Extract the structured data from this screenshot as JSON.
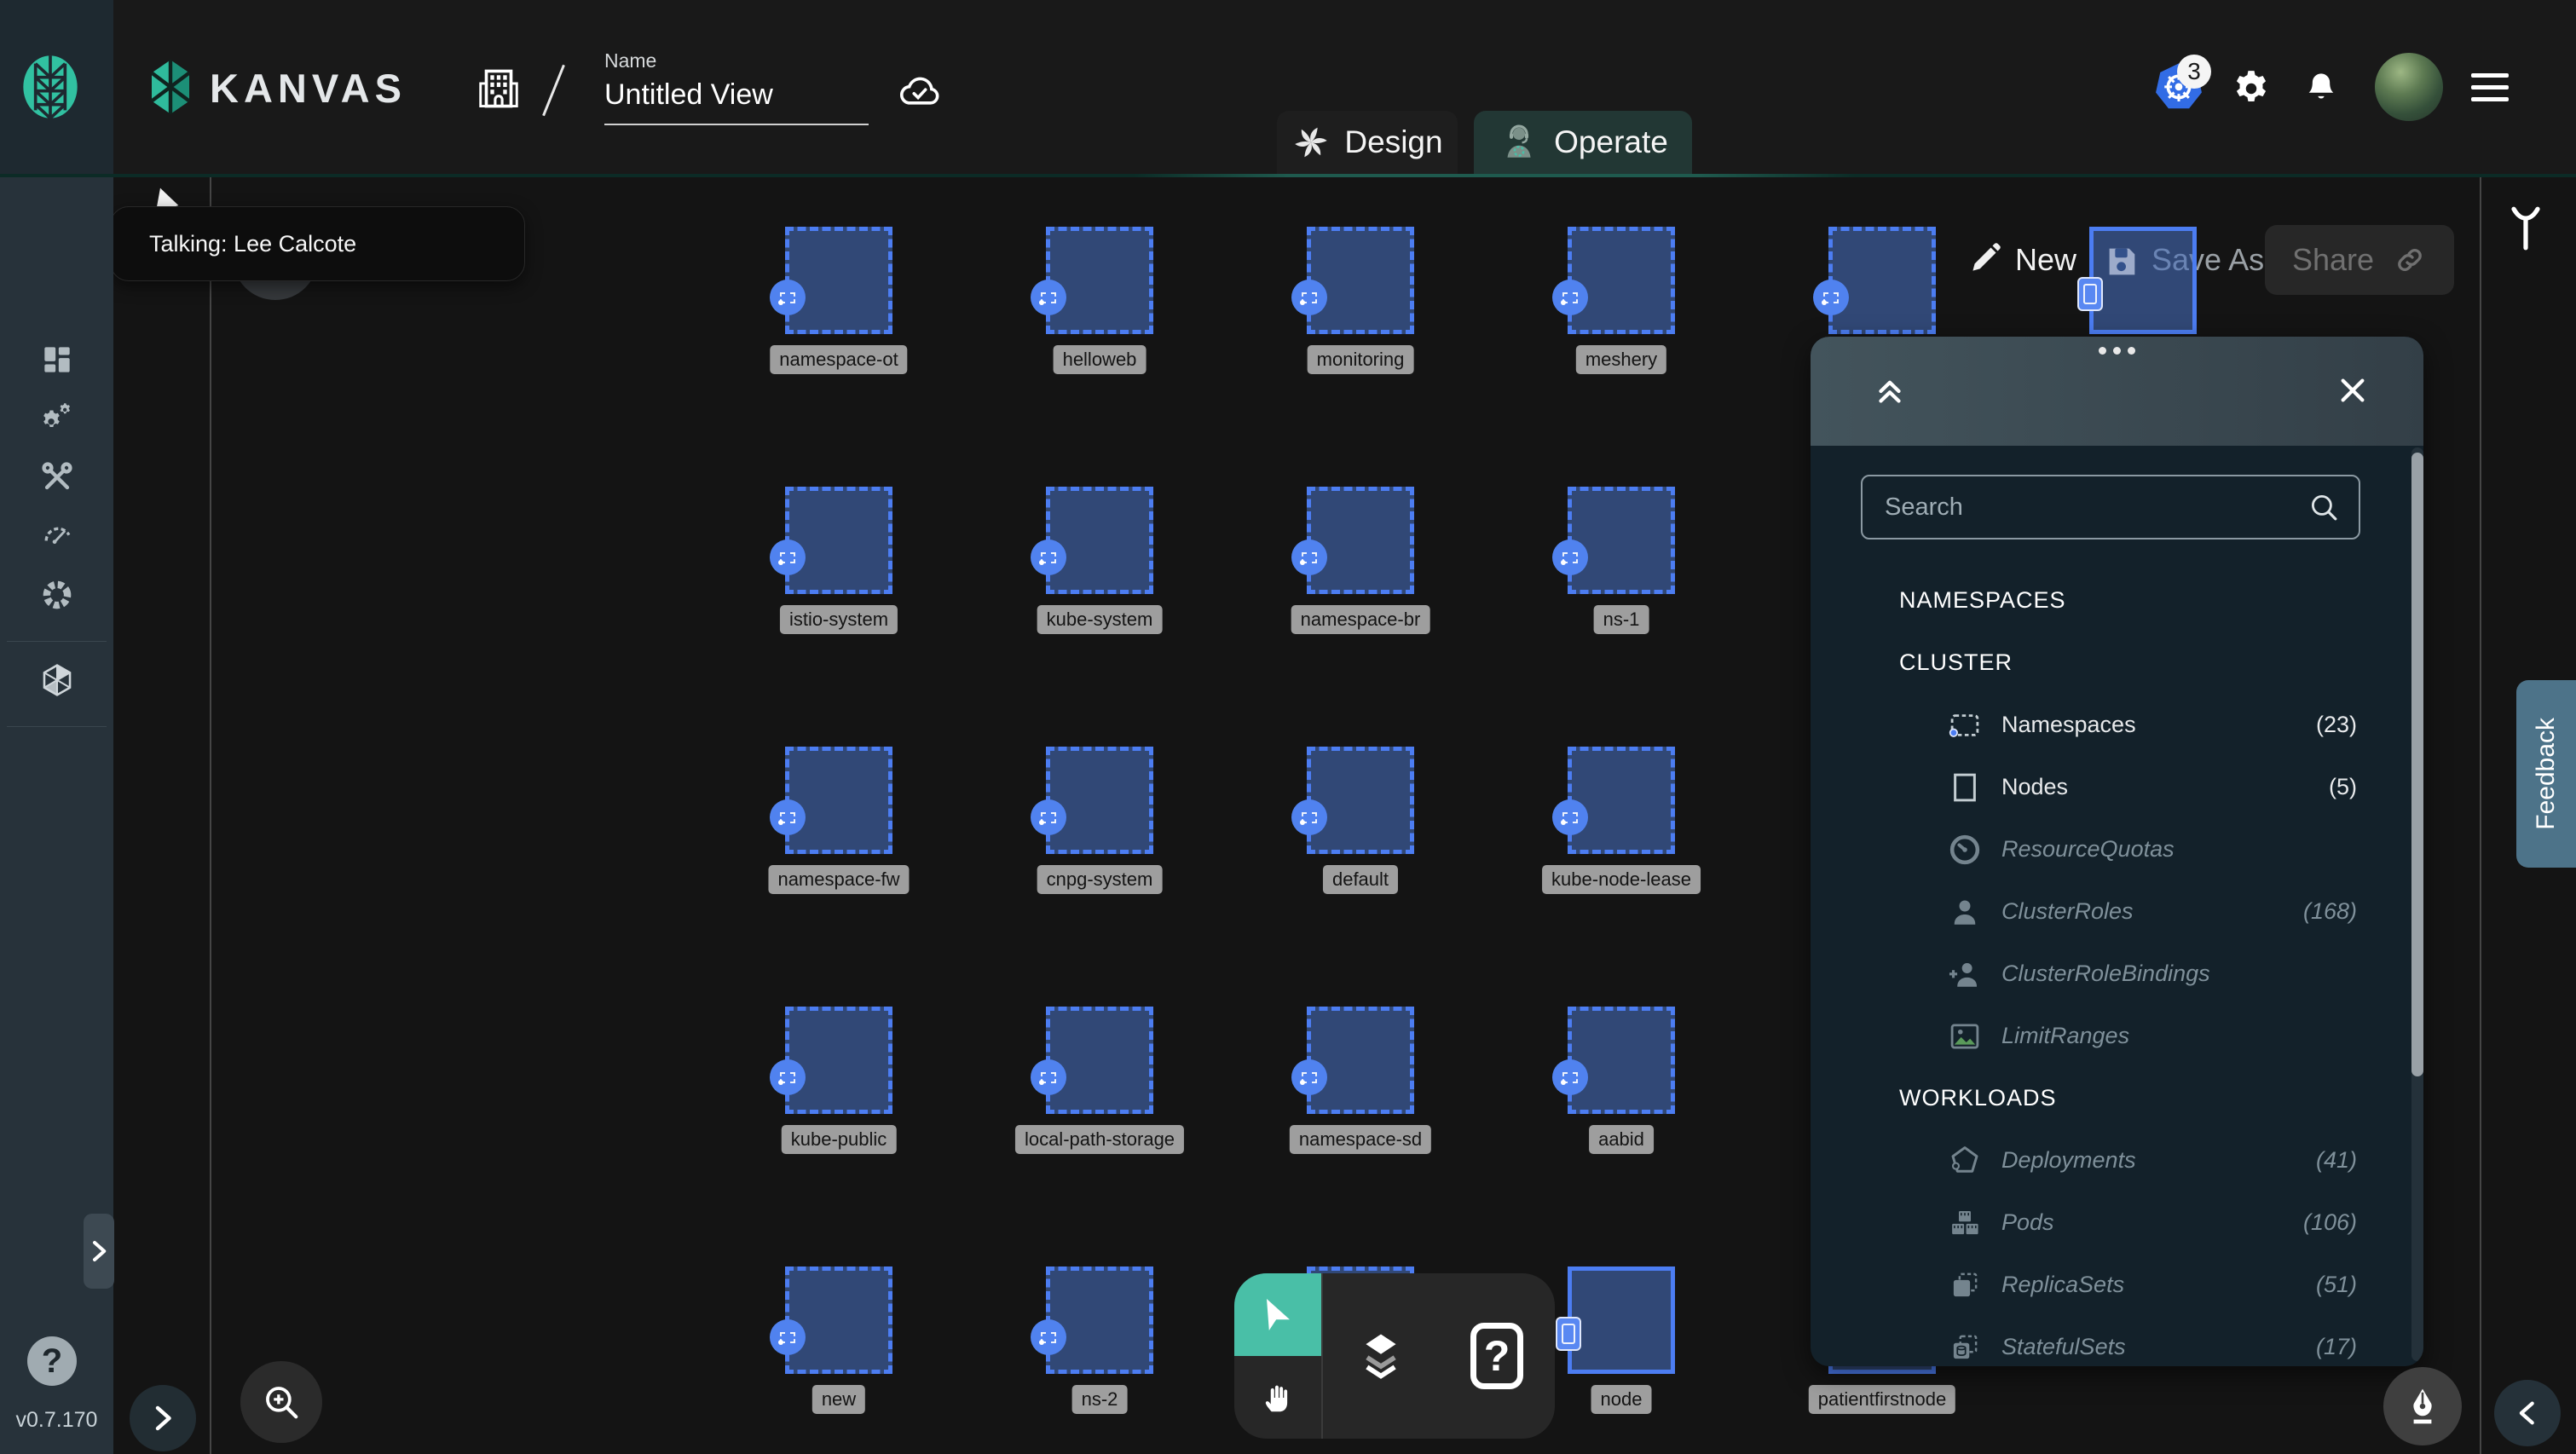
{
  "header": {
    "brand": "KANVAS",
    "name_label": "Name",
    "name_value": "Untitled View",
    "k8s_badge_count": "3",
    "tabs": {
      "design": "Design",
      "operate": "Operate"
    }
  },
  "sidebar": {
    "version": "v0.7.170",
    "help_glyph": "?",
    "icons": [
      "dashboard-icon",
      "lifecycle-gears-icon",
      "toolkit-wrenches-icon",
      "performance-gauge-icon",
      "extensions-ring-icon",
      "meshery-hexagon-icon"
    ]
  },
  "canvas": {
    "tooltip_text": "Talking: Lee Calcote",
    "actions": {
      "new": "New",
      "save_as": "Save As",
      "share": "Share"
    },
    "nodes": [
      {
        "label": "namespace-ot",
        "col": 0,
        "row": 0,
        "type": "namespace",
        "show_label": true
      },
      {
        "label": "helloweb",
        "col": 1,
        "row": 0,
        "type": "namespace",
        "show_label": true
      },
      {
        "label": "monitoring",
        "col": 2,
        "row": 0,
        "type": "namespace",
        "show_label": true
      },
      {
        "label": "meshery",
        "col": 3,
        "row": 0,
        "type": "namespace",
        "show_label": true
      },
      {
        "label": "",
        "col": 4,
        "row": 0,
        "type": "namespace",
        "show_label": false
      },
      {
        "label": "",
        "col": 5,
        "row": 0,
        "type": "node",
        "show_label": false
      },
      {
        "label": "istio-system",
        "col": 0,
        "row": 1,
        "type": "namespace",
        "show_label": true
      },
      {
        "label": "kube-system",
        "col": 1,
        "row": 1,
        "type": "namespace",
        "show_label": true
      },
      {
        "label": "namespace-br",
        "col": 2,
        "row": 1,
        "type": "namespace",
        "show_label": true
      },
      {
        "label": "ns-1",
        "col": 3,
        "row": 1,
        "type": "namespace",
        "show_label": true
      },
      {
        "label": "namespace-fw",
        "col": 0,
        "row": 2,
        "type": "namespace",
        "show_label": true
      },
      {
        "label": "cnpg-system",
        "col": 1,
        "row": 2,
        "type": "namespace",
        "show_label": true
      },
      {
        "label": "default",
        "col": 2,
        "row": 2,
        "type": "namespace",
        "show_label": true
      },
      {
        "label": "kube-node-lease",
        "col": 3,
        "row": 2,
        "type": "namespace",
        "show_label": true
      },
      {
        "label": "kube-public",
        "col": 0,
        "row": 3,
        "type": "namespace",
        "show_label": true
      },
      {
        "label": "local-path-storage",
        "col": 1,
        "row": 3,
        "type": "namespace",
        "show_label": true
      },
      {
        "label": "namespace-sd",
        "col": 2,
        "row": 3,
        "type": "namespace",
        "show_label": true
      },
      {
        "label": "aabid",
        "col": 3,
        "row": 3,
        "type": "namespace",
        "show_label": true
      },
      {
        "label": "new",
        "col": 0,
        "row": 4,
        "type": "namespace",
        "show_label": true
      },
      {
        "label": "ns-2",
        "col": 1,
        "row": 4,
        "type": "namespace",
        "show_label": true
      },
      {
        "label": "",
        "col": 2,
        "row": 4,
        "type": "namespace",
        "show_label": false
      },
      {
        "label": "node",
        "col": 3,
        "row": 4,
        "type": "node",
        "show_label": true
      },
      {
        "label": "patientfirstnode",
        "col": 4,
        "row": 4,
        "type": "node",
        "show_label": true
      }
    ]
  },
  "panel": {
    "search_placeholder": "Search",
    "sections": [
      {
        "header": "NAMESPACES",
        "items": []
      },
      {
        "header": "CLUSTER",
        "items": [
          {
            "icon": "namespace-icon",
            "label": "Namespaces",
            "count": "(23)",
            "enabled": true
          },
          {
            "icon": "node-icon",
            "label": "Nodes",
            "count": "(5)",
            "enabled": true
          },
          {
            "icon": "resourcequota-icon",
            "label": "ResourceQuotas",
            "count": "",
            "enabled": false
          },
          {
            "icon": "clusterrole-icon",
            "label": "ClusterRoles",
            "count": "(168)",
            "enabled": false
          },
          {
            "icon": "clusterrolebinding-icon",
            "label": "ClusterRoleBindings",
            "count": "",
            "enabled": false
          },
          {
            "icon": "limitrange-icon",
            "label": "LimitRanges",
            "count": "",
            "enabled": false
          }
        ]
      },
      {
        "header": "WORKLOADS",
        "items": [
          {
            "icon": "deployment-icon",
            "label": "Deployments",
            "count": "(41)",
            "enabled": false
          },
          {
            "icon": "pod-icon",
            "label": "Pods",
            "count": "(106)",
            "enabled": false
          },
          {
            "icon": "replicaset-icon",
            "label": "ReplicaSets",
            "count": "(51)",
            "enabled": false
          },
          {
            "icon": "statefulset-icon",
            "label": "StatefulSets",
            "count": "(17)",
            "enabled": false
          }
        ]
      }
    ]
  },
  "feedback_label": "Feedback",
  "toolbar": {
    "help_glyph": "?"
  },
  "colors": {
    "accent_blue": "#4c7df2",
    "node_fill": "#2d4677",
    "teal": "#49bfa7",
    "k8s_blue": "#326ce5",
    "feedback_bg": "#4d7389",
    "label_chip": "#9e9e9e"
  }
}
